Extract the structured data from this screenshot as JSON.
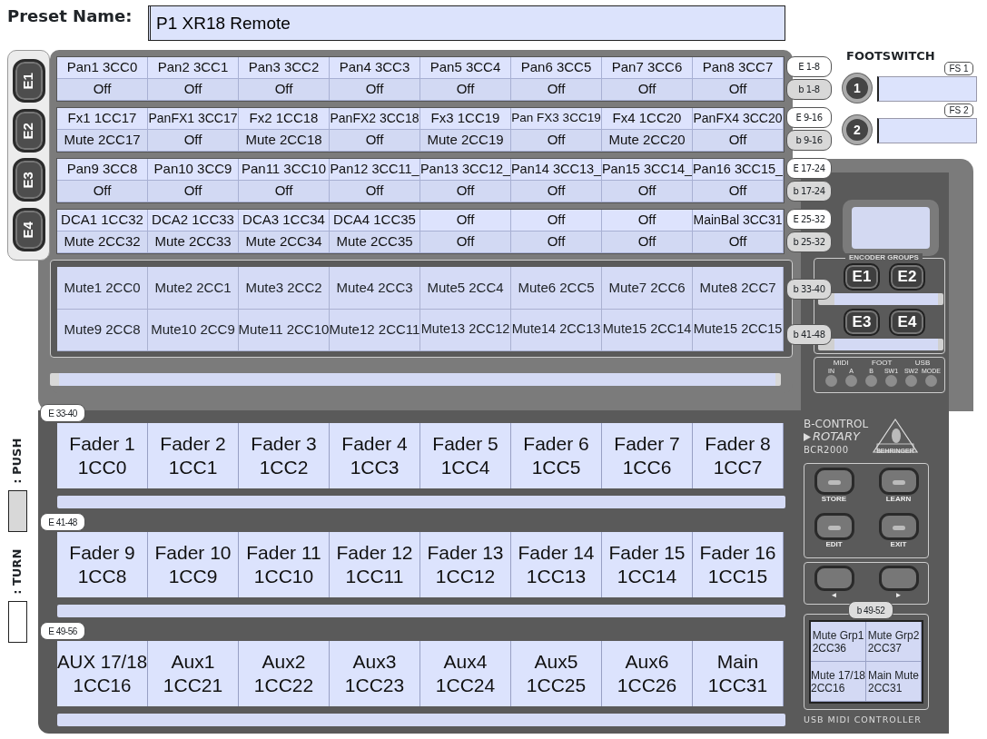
{
  "preset_name": {
    "label": "Preset Name:",
    "value": "P1 XR18 Remote"
  },
  "group_tabs": [
    "E1",
    "E2",
    "E3",
    "E4"
  ],
  "encoder_rows": [
    {
      "top_tag": "E 1-8",
      "bottom_tag": "b 1-8",
      "top": [
        "Pan1 3CC0",
        "Pan2 3CC1",
        "Pan3 3CC2",
        "Pan4 3CC3",
        "Pan5 3CC4",
        "Pan6 3CC5",
        "Pan7 3CC6",
        "Pan8 3CC7"
      ],
      "bottom": [
        "Off",
        "Off",
        "Off",
        "Off",
        "Off",
        "Off",
        "Off",
        "Off"
      ]
    },
    {
      "top_tag": "E 9-16",
      "bottom_tag": "b 9-16",
      "top": [
        "Fx1 1CC17",
        "PanFX1 3CC17",
        "Fx2 1CC18",
        "PanFX2 3CC18",
        "Fx3 1CC19",
        "Pan FX3 3CC19",
        "Fx4 1CC20",
        "PanFX4 3CC20"
      ],
      "bottom": [
        "Mute 2CC17",
        "Off",
        "Mute 2CC18",
        "Off",
        "Mute 2CC19",
        "Off",
        "Mute 2CC20",
        "Off"
      ]
    },
    {
      "top_tag": "E 17-24",
      "bottom_tag": "b 17-24",
      "top": [
        "Pan9 3CC8",
        "Pan10 3CC9",
        "Pan11 3CC10",
        "Pan12 3CC11_",
        "Pan13 3CC12_",
        "Pan14 3CC13_",
        "Pan15 3CC14_",
        "Pan16 3CC15_"
      ],
      "bottom": [
        "Off",
        "Off",
        "Off",
        "Off",
        "Off",
        "Off",
        "Off",
        "Off"
      ]
    },
    {
      "top_tag": "E 25-32",
      "bottom_tag": "b 25-32",
      "top": [
        "DCA1 1CC32",
        "DCA2 1CC33",
        "DCA3 1CC34",
        "DCA4 1CC35",
        "Off",
        "Off",
        "Off",
        "MainBal 3CC31"
      ],
      "bottom": [
        "Mute 2CC32",
        "Mute 2CC33",
        "Mute 2CC34",
        "Mute 2CC35",
        "Off",
        "Off",
        "Off",
        "Off"
      ]
    }
  ],
  "mute_rows": [
    {
      "tag": "b 33-40",
      "cells": [
        "Mute1 2CC0",
        "Mute2 2CC1",
        "Mute3 2CC2",
        "Mute4 2CC3",
        "Mute5 2CC4",
        "Mute6 2CC5",
        "Mute7 2CC6",
        "Mute8 2CC7"
      ]
    },
    {
      "tag": "b 41-48",
      "cells": [
        "Mute9 2CC8",
        "Mute10 2CC9",
        "Mute11 2CC10",
        "Mute12 2CC11",
        "Mute13 2CC12",
        "Mute14 2CC13",
        "Mute15 2CC14",
        "Mute15 2CC15"
      ]
    }
  ],
  "footswitch": {
    "title": "FOOTSWITCH",
    "switches": [
      {
        "number": "1",
        "tag": "FS 1"
      },
      {
        "number": "2",
        "tag": "FS 2"
      }
    ]
  },
  "device": {
    "encoder_groups_label": "ENCODER GROUPS",
    "group_buttons": [
      "E1",
      "E2",
      "E3",
      "E4"
    ],
    "led_groups": [
      "MIDI",
      "FOOT",
      "USB"
    ],
    "leds": [
      "IN",
      "A",
      "B",
      "SW1",
      "SW2",
      "MODE"
    ]
  },
  "legend": [
    {
      "kind": "push",
      "label": ": PUSH"
    },
    {
      "kind": "turn",
      "label": ": TURN"
    }
  ],
  "fader_rows": [
    {
      "tag": "E 33-40",
      "cells": [
        {
          "name": "Fader 1",
          "cc": "1CC0"
        },
        {
          "name": "Fader 2",
          "cc": "1CC1"
        },
        {
          "name": "Fader 3",
          "cc": "1CC2"
        },
        {
          "name": "Fader 4",
          "cc": "1CC3"
        },
        {
          "name": "Fader 5",
          "cc": "1CC4"
        },
        {
          "name": "Fader 6",
          "cc": "1CC5"
        },
        {
          "name": "Fader 7",
          "cc": "1CC6"
        },
        {
          "name": "Fader 8",
          "cc": "1CC7"
        }
      ]
    },
    {
      "tag": "E 41-48",
      "cells": [
        {
          "name": "Fader 9",
          "cc": "1CC8"
        },
        {
          "name": "Fader 10",
          "cc": "1CC9"
        },
        {
          "name": "Fader 11",
          "cc": "1CC10"
        },
        {
          "name": "Fader 12",
          "cc": "1CC11"
        },
        {
          "name": "Fader 13",
          "cc": "1CC12"
        },
        {
          "name": "Fader 14",
          "cc": "1CC13"
        },
        {
          "name": "Fader 15",
          "cc": "1CC14"
        },
        {
          "name": "Fader 16",
          "cc": "1CC15"
        }
      ]
    },
    {
      "tag": "E 49-56",
      "cells": [
        {
          "name": "AUX 17/18",
          "cc": "1CC16"
        },
        {
          "name": "Aux1",
          "cc": "1CC21"
        },
        {
          "name": "Aux2",
          "cc": "1CC22"
        },
        {
          "name": "Aux3",
          "cc": "1CC23"
        },
        {
          "name": "Aux4",
          "cc": "1CC24"
        },
        {
          "name": "Aux5",
          "cc": "1CC25"
        },
        {
          "name": "Aux6",
          "cc": "1CC26"
        },
        {
          "name": "Main",
          "cc": "1CC31"
        }
      ]
    }
  ],
  "brand": {
    "line1": "B-CONTROL",
    "line2": "ROTARY",
    "model": "BCR2000",
    "maker": "BEHRINGER",
    "footer": "USB MIDI CONTROLLER"
  },
  "function_buttons": [
    "STORE",
    "LEARN",
    "EDIT",
    "EXIT"
  ],
  "arrow_buttons": [
    "◄",
    "►"
  ],
  "button_grid": {
    "tag": "b 49-52",
    "cells": [
      {
        "name": "Mute Grp1",
        "cc": "2CC36"
      },
      {
        "name": "Mute Grp2",
        "cc": "2CC37"
      },
      {
        "name": "Mute 17/18",
        "cc": "2CC16"
      },
      {
        "name": "Main Mute",
        "cc": "2CC31"
      }
    ]
  }
}
